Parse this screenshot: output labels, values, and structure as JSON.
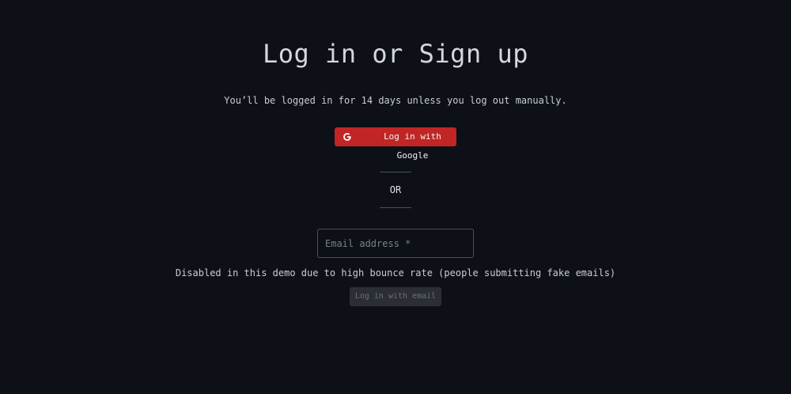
{
  "header": {
    "title": "Log in or Sign up",
    "subtitle": "You’ll be logged in for 14 days unless you log out manually."
  },
  "google_login": {
    "label": "Log in with Google",
    "icon": "google-g-icon",
    "color": "#c22525"
  },
  "separator": {
    "text": "OR"
  },
  "email_login": {
    "placeholder": "Email address *",
    "note": "Disabled in this demo due to high bounce rate (people submitting fake emails)",
    "button_label": "Log in with email"
  }
}
